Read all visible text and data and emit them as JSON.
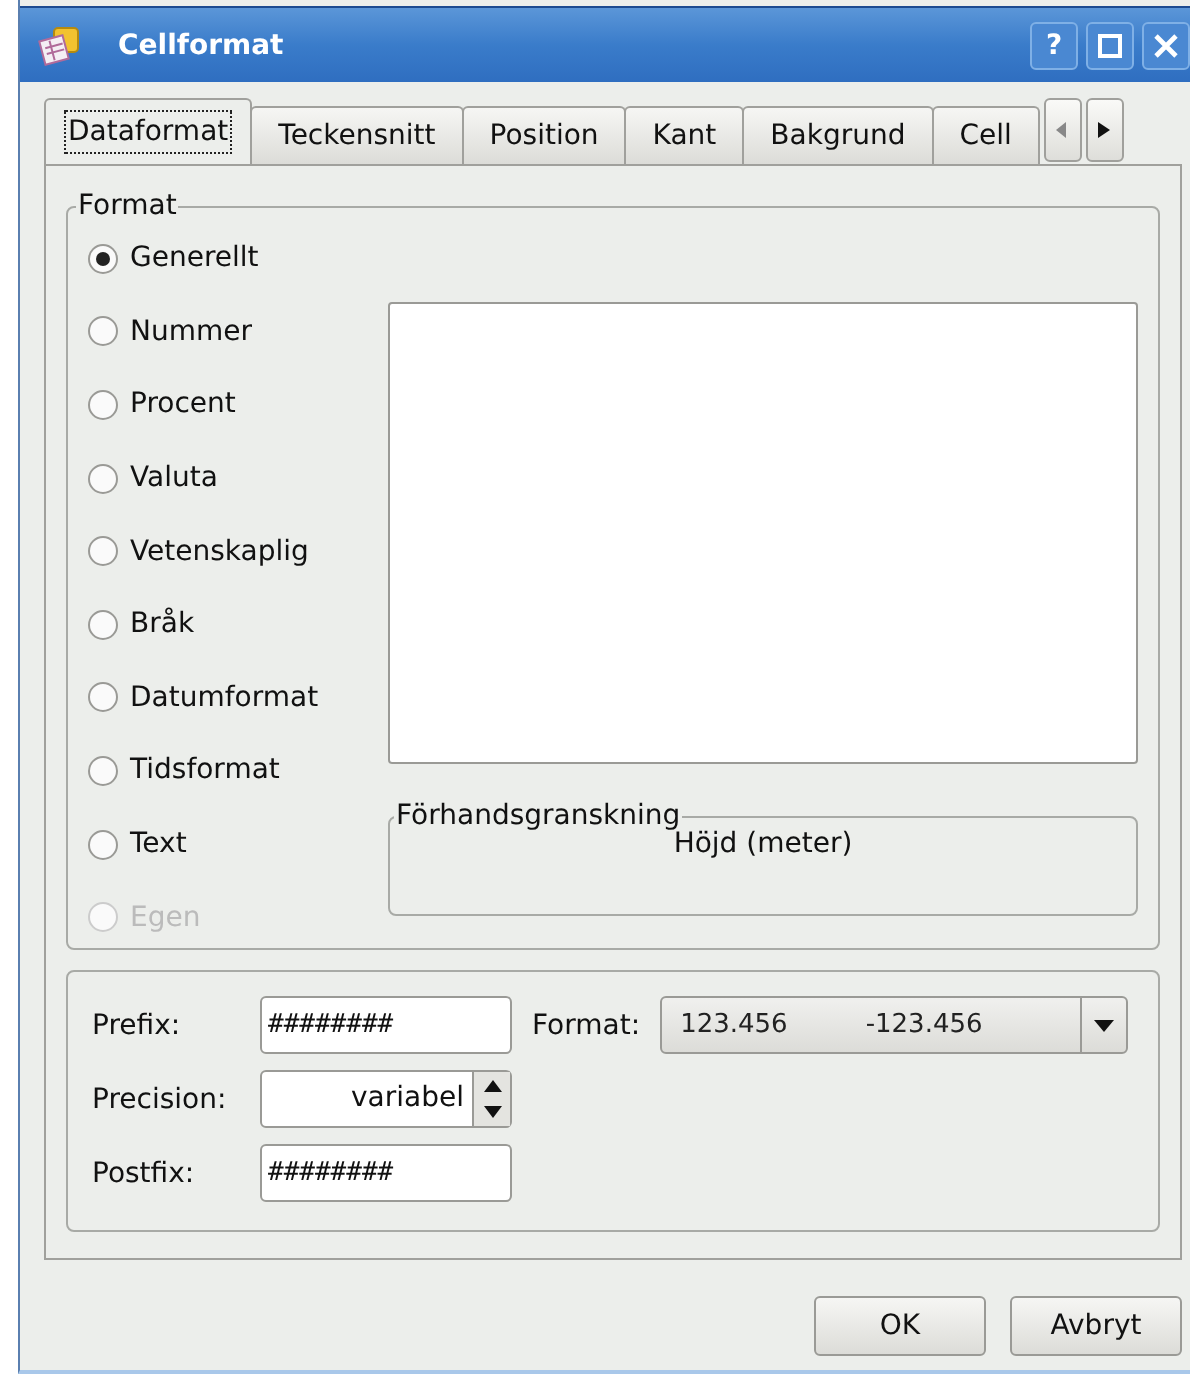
{
  "window": {
    "title": "Cellformat",
    "help": "?"
  },
  "tabs": [
    {
      "label": "Dataformat",
      "selected": true
    },
    {
      "label": "Teckensnitt",
      "selected": false
    },
    {
      "label": "Position",
      "selected": false
    },
    {
      "label": "Kant",
      "selected": false
    },
    {
      "label": "Bakgrund",
      "selected": false
    },
    {
      "label": "Cell",
      "selected": false
    }
  ],
  "format_group": {
    "title": "Format",
    "options": [
      {
        "label": "Generellt",
        "selected": true,
        "disabled": false
      },
      {
        "label": "Nummer",
        "selected": false,
        "disabled": false
      },
      {
        "label": "Procent",
        "selected": false,
        "disabled": false
      },
      {
        "label": "Valuta",
        "selected": false,
        "disabled": false
      },
      {
        "label": "Vetenskaplig",
        "selected": false,
        "disabled": false
      },
      {
        "label": "Bråk",
        "selected": false,
        "disabled": false
      },
      {
        "label": "Datumformat",
        "selected": false,
        "disabled": false
      },
      {
        "label": "Tidsformat",
        "selected": false,
        "disabled": false
      },
      {
        "label": "Text",
        "selected": false,
        "disabled": false
      },
      {
        "label": "Egen",
        "selected": false,
        "disabled": true
      }
    ],
    "preview": {
      "title": "Förhandsgranskning",
      "text": "Höjd (meter)"
    }
  },
  "prefix": {
    "label": "Prefix:",
    "value": "########"
  },
  "format": {
    "label": "Format:",
    "positive": "123.456",
    "negative": "-123.456"
  },
  "precision": {
    "label": "Precision:",
    "value": "variabel"
  },
  "postfix": {
    "label": "Postfix:",
    "value": "########"
  },
  "buttons": [
    "OK",
    "Avbryt"
  ]
}
